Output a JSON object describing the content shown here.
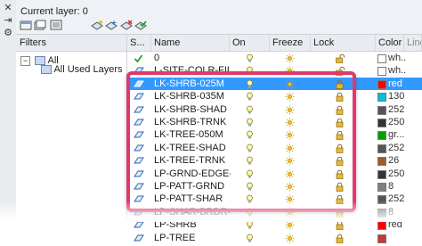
{
  "side_strip": {
    "icons": [
      "close-icon",
      "auto-hide-icon",
      "properties-icon"
    ]
  },
  "header": {
    "current_layer_label": "Current layer: 0"
  },
  "toolbar": {
    "icons": [
      "new-property-filter-icon",
      "new-group-filter-icon",
      "layer-states-manager-icon",
      "new-layer-icon",
      "new-layer-vp-frozen-icon",
      "delete-layer-icon",
      "set-current-icon"
    ]
  },
  "filters": {
    "title": "Filters",
    "tree": [
      {
        "label": "All",
        "expanded": true
      },
      {
        "label": "All Used Layers"
      }
    ]
  },
  "layers": {
    "columns": [
      "S...",
      "Name",
      "On",
      "Freeze",
      "Lock",
      "Color",
      "Line"
    ],
    "rows": [
      {
        "name": "0",
        "color_name": "wh...",
        "color_hex": "#ffffff",
        "status": "current",
        "lock": "unlocked"
      },
      {
        "name": "L-SITE-COLR-FILL",
        "color_name": "wh...",
        "color_hex": "#ffffff",
        "status": "layer",
        "lock": "unlocked"
      },
      {
        "name": "LK-SHRB-025M",
        "color_name": "red",
        "color_hex": "#ff0000",
        "status": "layer",
        "lock": "locked",
        "selected": true
      },
      {
        "name": "LK-SHRB-035M",
        "color_name": "130",
        "color_hex": "#00bfe0",
        "status": "layer",
        "lock": "locked"
      },
      {
        "name": "LK-SHRB-SHAD",
        "color_name": "252",
        "color_hex": "#555555",
        "status": "layer",
        "lock": "locked"
      },
      {
        "name": "LK-SHRB-TRNK",
        "color_name": "250",
        "color_hex": "#333333",
        "status": "layer",
        "lock": "locked"
      },
      {
        "name": "LK-TREE-050M",
        "color_name": "gr...",
        "color_hex": "#00a000",
        "status": "layer",
        "lock": "locked"
      },
      {
        "name": "LK-TREE-SHAD",
        "color_name": "252",
        "color_hex": "#555555",
        "status": "layer",
        "lock": "locked"
      },
      {
        "name": "LK-TREE-TRNK",
        "color_name": "26",
        "color_hex": "#a05a2a",
        "status": "layer",
        "lock": "locked"
      },
      {
        "name": "LP-GRND-EDGE-NPLT",
        "color_name": "250",
        "color_hex": "#333333",
        "status": "layer",
        "lock": "locked"
      },
      {
        "name": "LP-PATT-GRND",
        "color_name": "8",
        "color_hex": "#808080",
        "status": "layer",
        "lock": "locked"
      },
      {
        "name": "LP-PATT-SHAR",
        "color_name": "252",
        "color_hex": "#555555",
        "status": "layer",
        "lock": "locked"
      },
      {
        "name": "LP-SHAR-BRDR-CENT",
        "color_name": "8",
        "color_hex": "#808080",
        "status": "layer",
        "lock": "locked"
      },
      {
        "name": "LP-SHRB",
        "color_name": "red",
        "color_hex": "#ff0000",
        "status": "layer",
        "lock": "locked"
      },
      {
        "name": "LP-TREE",
        "color_name": "",
        "color_hex": "#c43a2e",
        "status": "layer",
        "lock": "locked"
      }
    ]
  },
  "accent": {
    "selection": "#3399ff",
    "callout_border": "#e0386a"
  }
}
